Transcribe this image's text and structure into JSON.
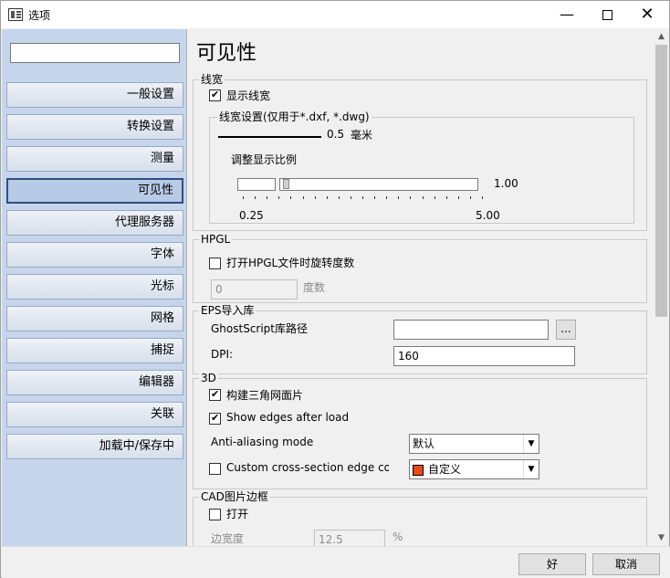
{
  "window": {
    "title": "选项",
    "minimize_glyph": "—",
    "close_glyph": "✕"
  },
  "sidebar": {
    "search_value": "",
    "items": [
      {
        "label": "一般设置"
      },
      {
        "label": "转换设置"
      },
      {
        "label": "测量"
      },
      {
        "label": "可见性",
        "active": true
      },
      {
        "label": "代理服务器"
      },
      {
        "label": "字体"
      },
      {
        "label": "光标"
      },
      {
        "label": "网格"
      },
      {
        "label": "捕捉"
      },
      {
        "label": "编辑器"
      },
      {
        "label": "关联"
      },
      {
        "label": "加载中/保存中"
      }
    ]
  },
  "page": {
    "title": "可见性"
  },
  "line_width": {
    "legend": "线宽",
    "show_lineweight_label": "显示线宽",
    "show_lineweight_checked": true,
    "settings_legend": "线宽设置(仅用于*.dxf, *.dwg)",
    "value": "0.5",
    "unit": "毫米",
    "scale_label": "调整显示比例",
    "scale_value": "1.00",
    "scale_min": "0.25",
    "scale_max": "5.00",
    "slider_fraction": 0.16
  },
  "hpgl": {
    "legend": "HPGL",
    "rotate_label": "打开HPGL文件时旋转度数",
    "rotate_checked": false,
    "degrees_value": "0",
    "degrees_unit": "度数"
  },
  "eps": {
    "legend": "EPS导入库",
    "ghost_label": "GhostScript库路径",
    "ghost_value": "",
    "browse_label": "...",
    "dpi_label": "DPI:",
    "dpi_value": "160"
  },
  "three_d": {
    "legend": "3D",
    "build_mesh_label": "构建三角网面片",
    "build_mesh_checked": true,
    "show_edges_label": "Show edges after load",
    "show_edges_checked": true,
    "aa_label": "Anti-aliasing mode",
    "aa_value": "默认",
    "custom_edge_label": "Custom cross-section edge color",
    "custom_edge_checked": false,
    "color_value": "自定义",
    "color_hex": "#e64a19"
  },
  "cad_border": {
    "legend": "CAD图片边框",
    "open_label": "打开",
    "open_checked": false,
    "width_label": "边宽度",
    "width_value": "12.5",
    "width_unit": "%"
  },
  "buttons": {
    "ok": "好",
    "cancel": "取消"
  },
  "colors": {
    "sidebar_bg": "#c5d5ec",
    "window_bg": "#f0f0f0"
  }
}
